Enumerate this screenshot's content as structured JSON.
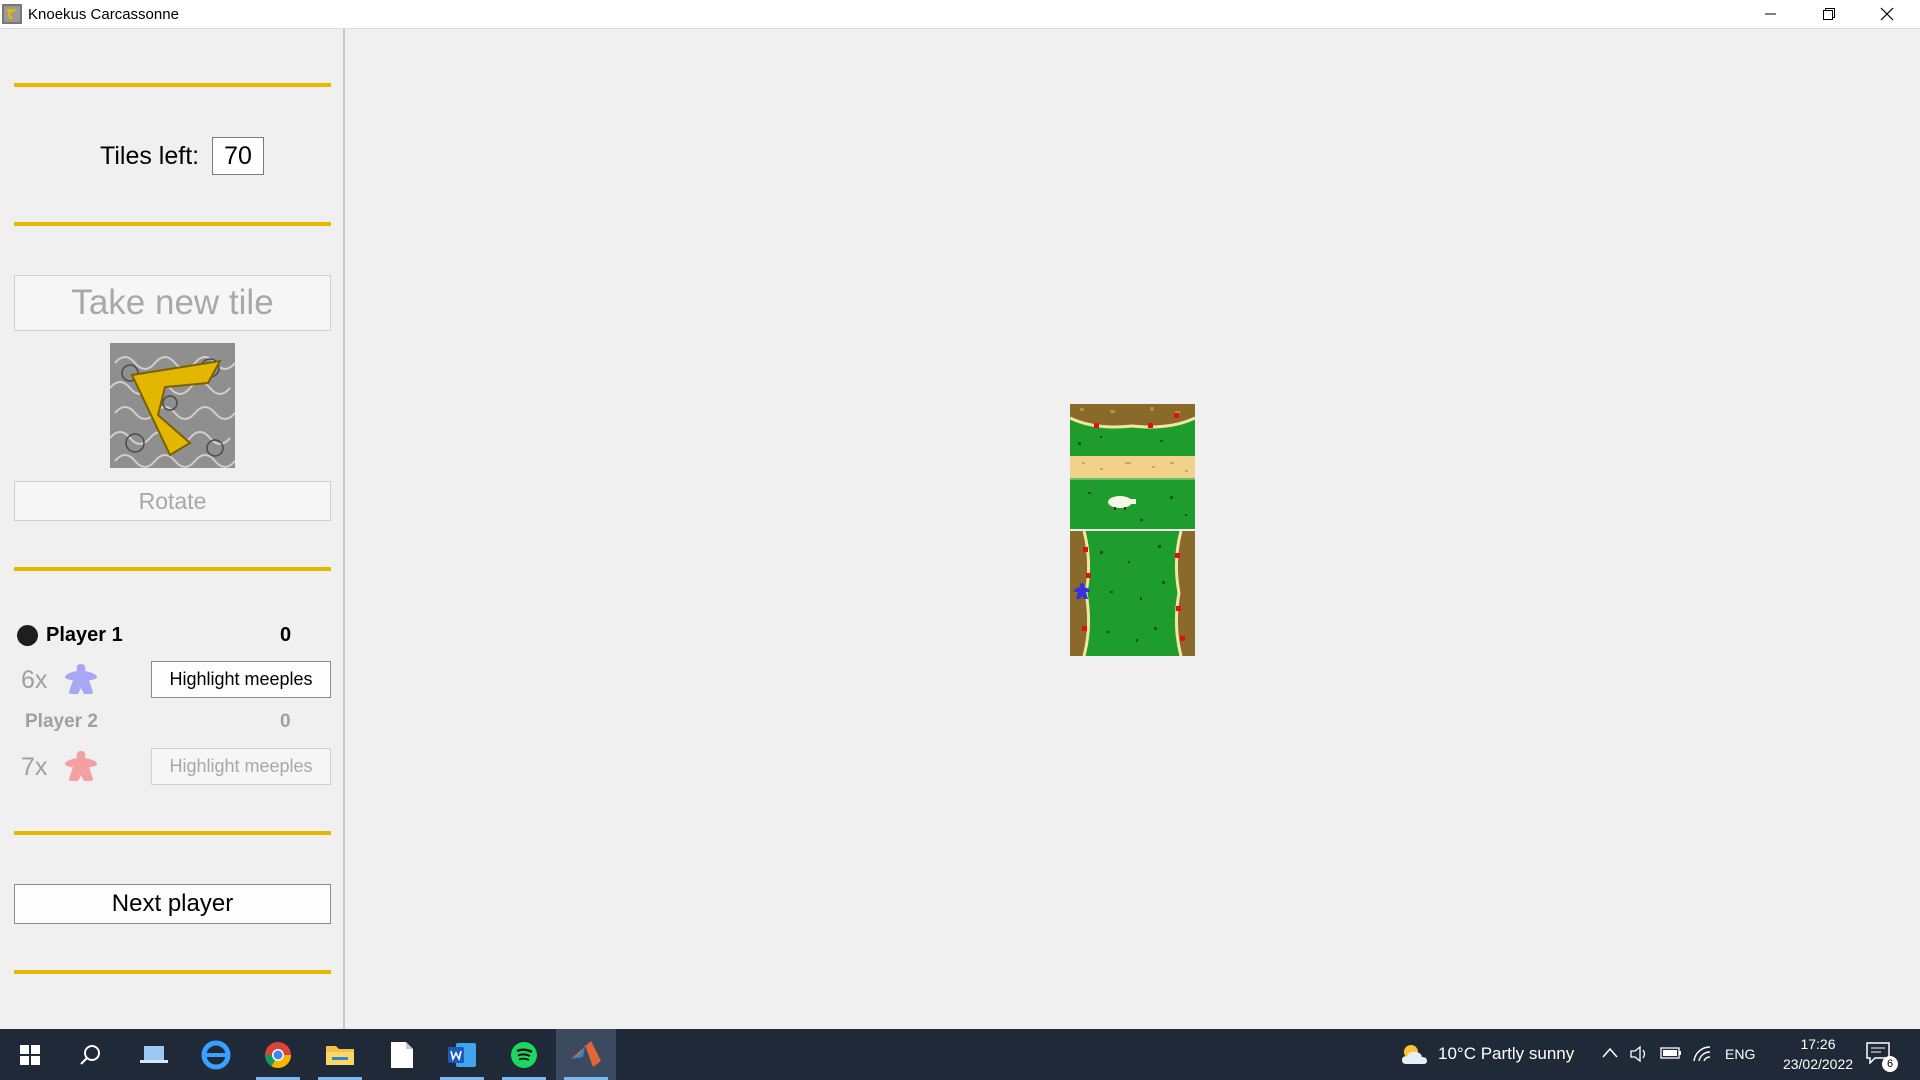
{
  "window": {
    "title": "Knoekus Carcassonne",
    "icons": [
      "app-icon",
      "minimize-icon",
      "restore-icon",
      "close-icon"
    ]
  },
  "panel": {
    "tiles_left_label": "Tiles left:",
    "tiles_left_value": "70",
    "take_tile_label": "Take new tile",
    "rotate_label": "Rotate",
    "next_player_label": "Next player",
    "divider_color": "#e6b800"
  },
  "players": [
    {
      "name": "Player 1",
      "score": "0",
      "meeples": "6x",
      "meeple_color": "#a7a7f4",
      "highlight_label": "Highlight meeples",
      "active": true
    },
    {
      "name": "Player 2",
      "score": "0",
      "meeples": "7x",
      "meeple_color": "#f4a0a0",
      "highlight_label": "Highlight meeples",
      "active": false
    }
  ],
  "board": {
    "tiles": [
      "city-cap-road-field",
      "field-city-sides"
    ],
    "placed_meeple_color": "#3333dd"
  },
  "taskbar": {
    "apps": [
      "start-icon",
      "search-icon",
      "task-view-icon",
      "edge-icon",
      "chrome-icon",
      "file-explorer-icon",
      "notepad-icon",
      "word-icon",
      "spotify-icon",
      "matlab-icon"
    ],
    "weather": "10°C  Partly sunny",
    "language": "ENG",
    "time": "17:26",
    "date": "23/02/2022",
    "notifications": "6"
  }
}
